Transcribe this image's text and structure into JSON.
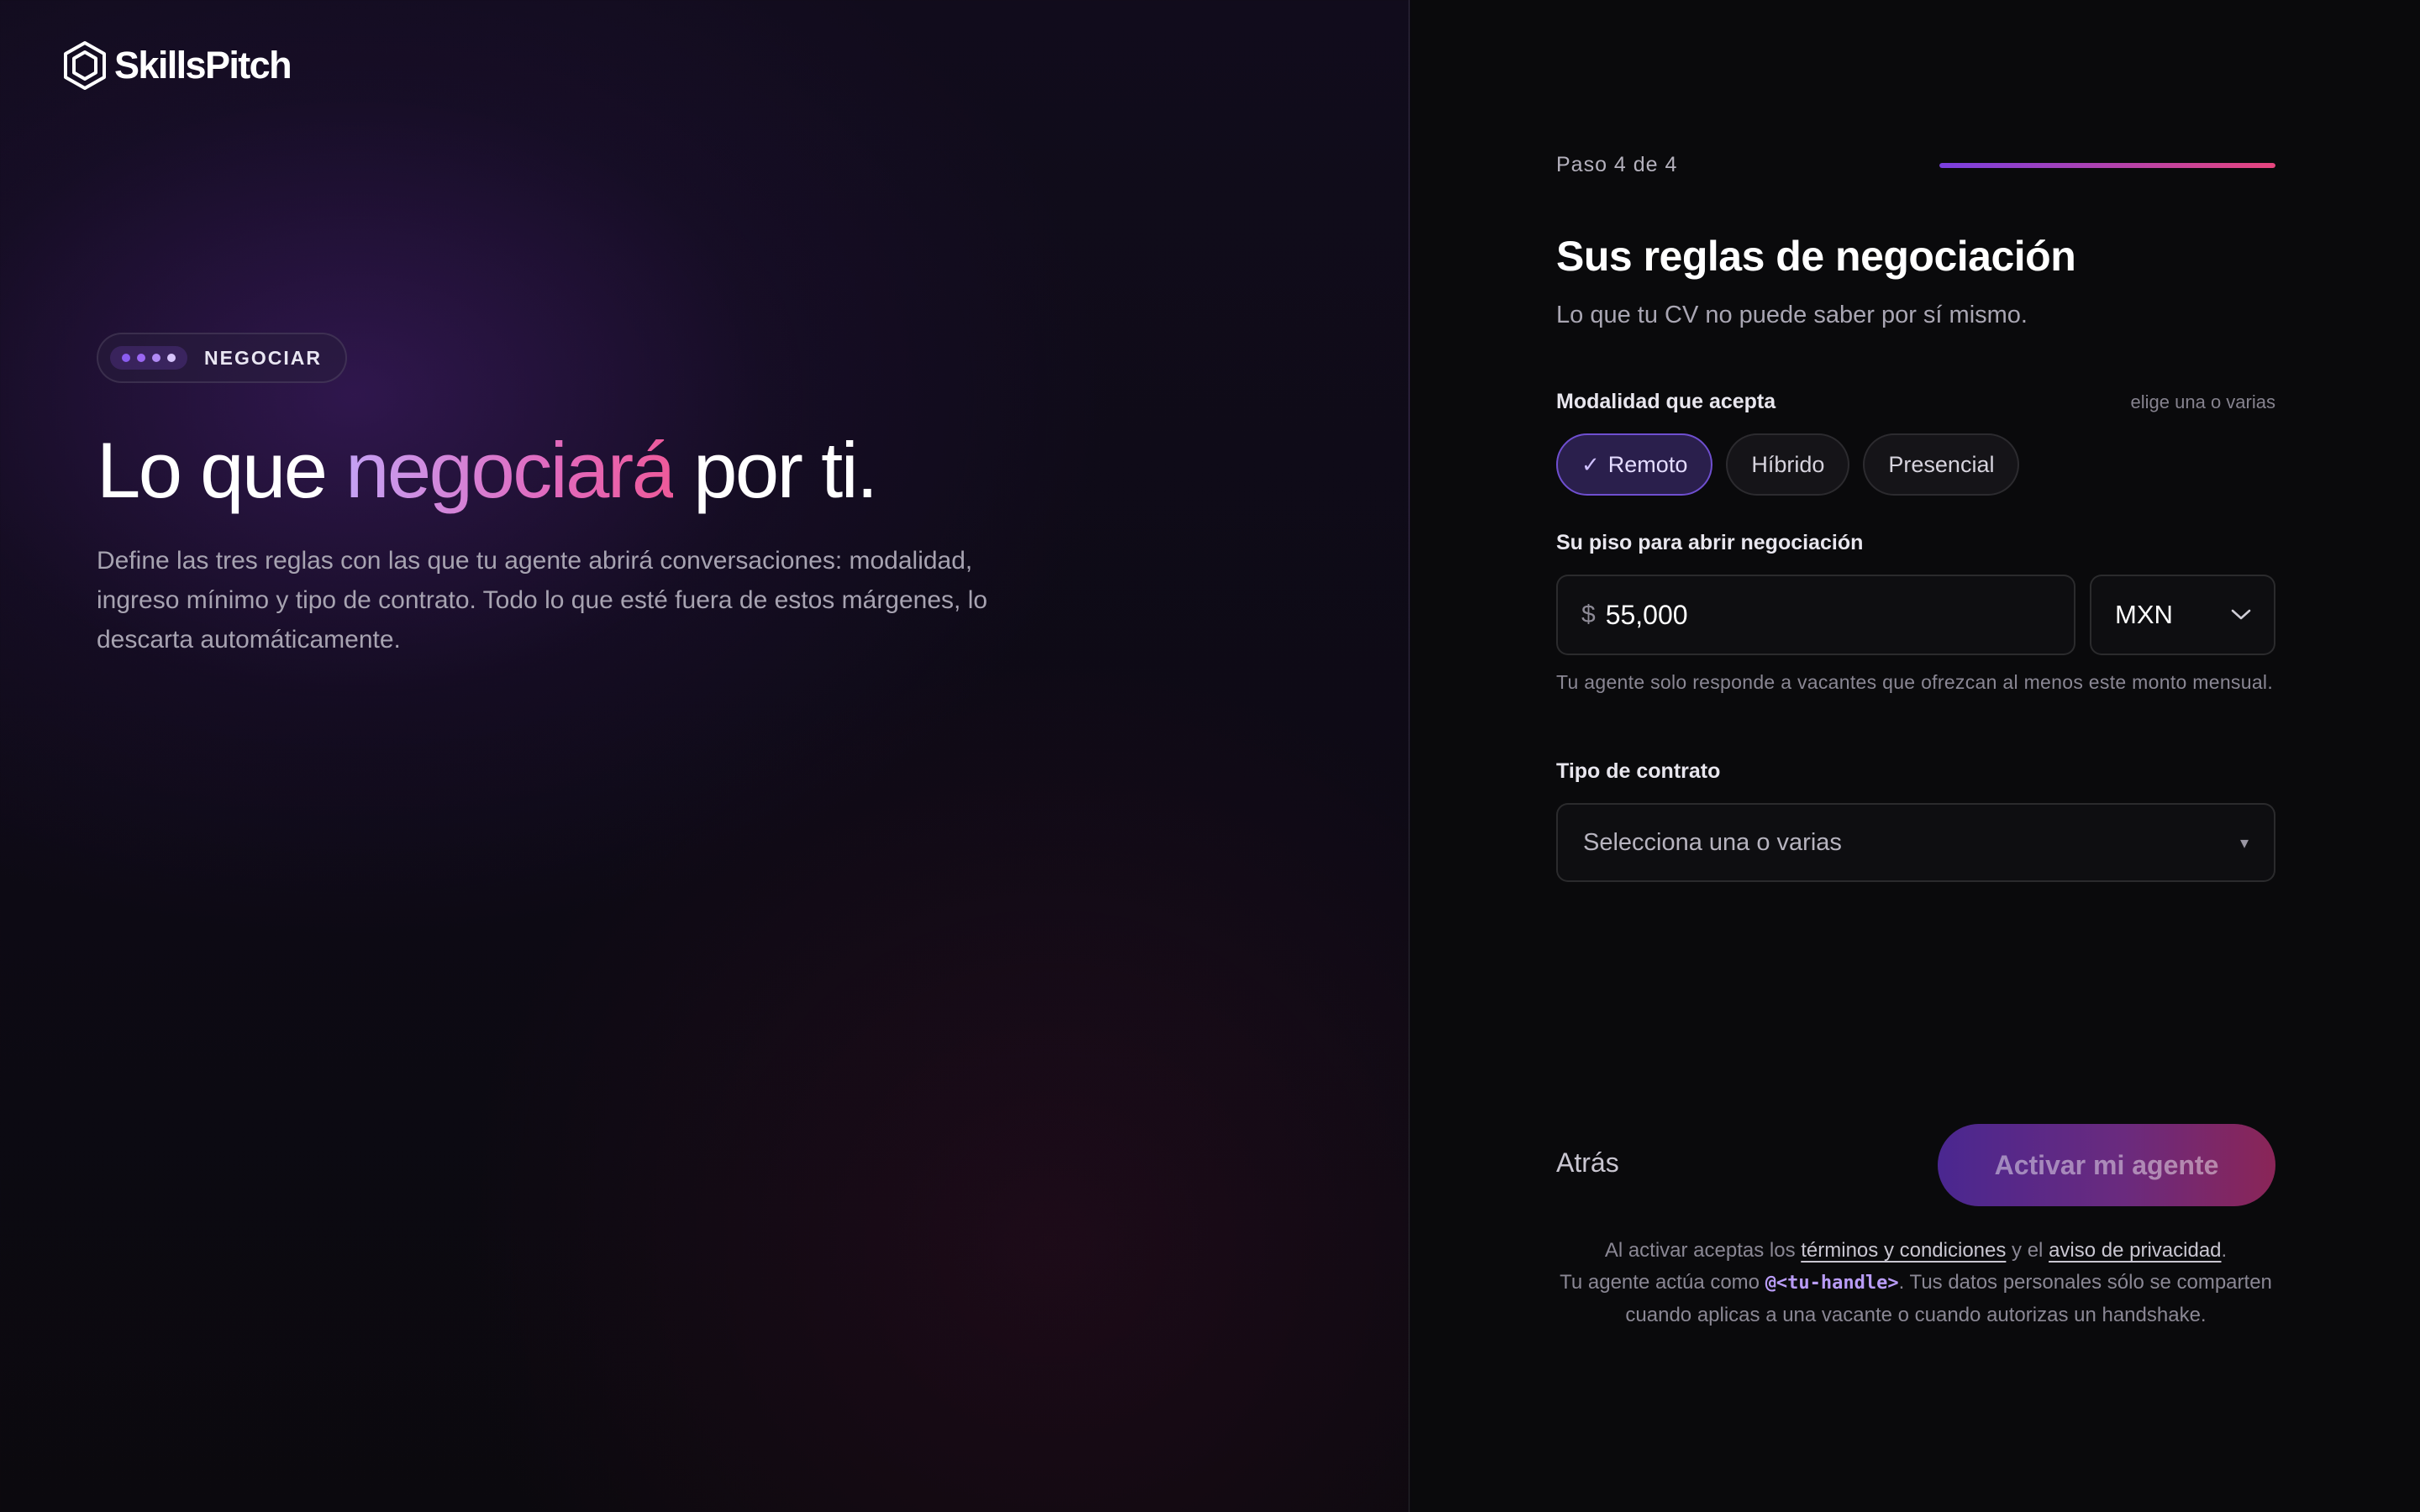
{
  "brand": {
    "name": "SkillsPitch",
    "icon": "hexagon-logo-icon"
  },
  "hero": {
    "badge_label": "NEGOCIAR",
    "badge_dot_colors": [
      "#8a5cf0",
      "#9a67f2",
      "#b18af5",
      "#d6c4fb"
    ],
    "title_before": "Lo que ",
    "title_accent": "negociará",
    "title_after": " por ti.",
    "description": "Define las tres reglas con las que tu agente abrirá conversaciones: modalidad, ingreso mínimo y tipo de contrato. Todo lo que esté fuera de estos márgenes, lo descarta automáticamente."
  },
  "progress": {
    "step_text": "Paso 4 de 4",
    "fraction": 1.0
  },
  "form": {
    "title": "Sus reglas de negociación",
    "subtitle": "Lo que tu CV no puede saber por sí mismo.",
    "modality": {
      "label": "Modalidad que acepta",
      "hint": "elige una o varias",
      "check_glyph": "✓",
      "options": [
        {
          "label": "Remoto",
          "selected": true
        },
        {
          "label": "Híbrido",
          "selected": false
        },
        {
          "label": "Presencial",
          "selected": false
        }
      ]
    },
    "salary": {
      "label": "Su piso para abrir negociación",
      "currency_symbol": "$",
      "amount": "55,000",
      "currency": "MXN",
      "help": "Tu agente solo responde a vacantes que ofrezcan al menos este monto mensual."
    },
    "contract": {
      "label": "Tipo de contrato",
      "placeholder": "Selecciona una o varias",
      "caret": "▾"
    }
  },
  "actions": {
    "back": "Atrás",
    "activate": "Activar mi agente"
  },
  "legal": {
    "p1": "Al activar aceptas los ",
    "terms": "términos y condiciones",
    "p2": " y el ",
    "privacy": "aviso de privacidad",
    "p3": ".",
    "p4": "Tu agente actúa como ",
    "handle": "@<tu-handle>",
    "p5": ". Tus datos personales sólo se comparten cuando aplicas a una vacante o cuando autorizas un handshake."
  },
  "colors": {
    "accent_purple": "#7a3fe0",
    "accent_pink": "#e7457e",
    "chip_selected_border": "#6f4fd0"
  }
}
